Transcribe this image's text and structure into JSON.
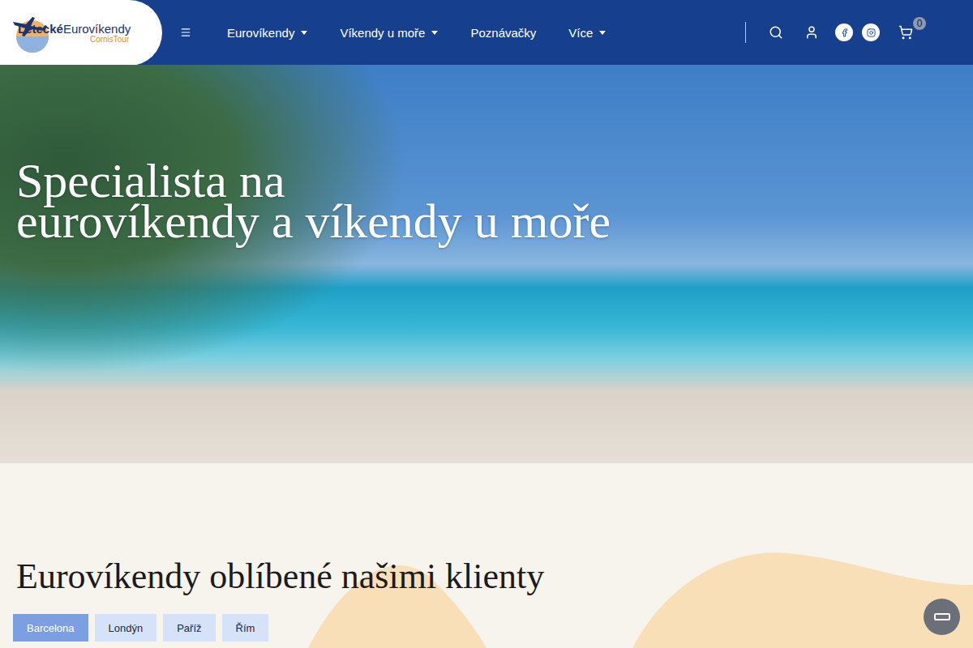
{
  "header": {
    "logo": {
      "bold": "Letecké",
      "regular": "Eurovíkendy",
      "sub": "CornisTour"
    },
    "nav": [
      {
        "label": "Eurovíkendy",
        "dropdown": true
      },
      {
        "label": "Víkendy u moře",
        "dropdown": true
      },
      {
        "label": "Poznávačky",
        "dropdown": false
      },
      {
        "label": "Více",
        "dropdown": true
      }
    ],
    "cart_count": "0"
  },
  "hero": {
    "title_lines": [
      "Specialista na",
      "eurovíkendy a víkendy u moře"
    ]
  },
  "popular": {
    "heading": "Eurovíkendy oblíbené našimi klienty",
    "tabs": [
      {
        "label": "Barcelona",
        "selected": true
      },
      {
        "label": "Londýn",
        "selected": false
      },
      {
        "label": "Paříž",
        "selected": false
      },
      {
        "label": "Řím",
        "selected": false
      }
    ]
  }
}
